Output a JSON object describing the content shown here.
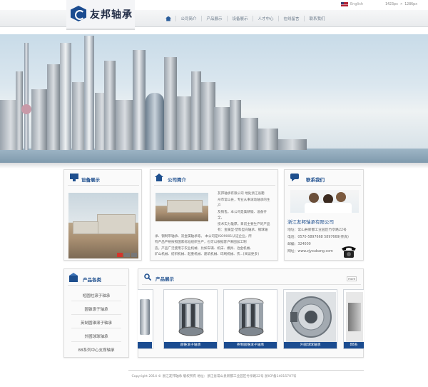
{
  "header": {
    "language": "English",
    "dimensions_note": "1423px × 1286px",
    "logo_text": "友邦轴承"
  },
  "nav": {
    "items": [
      "公司简介",
      "产品展示",
      "设备展示",
      "人才中心",
      "在线留言",
      "联系我们"
    ]
  },
  "equipment": {
    "title": "设备展示"
  },
  "about": {
    "title": "公司简介",
    "lines": [
      "友邦轴承有限公司 地处浙江省衢",
      "州市常山县，专业从事滚动轴承的生产",
      "及销售。本公司是集精锻、设备齐全，",
      "技术实力雄厚。目前主要生产的产品",
      "有：金属型·塑料型向轴承、钢球轴",
      "承、钢制带轴承、双金属轴承等。   本公司是ISO9001认证企业，所",
      "有产品严格按照国家标准组织生产，也可以根据客户来图加工制",
      "造。产品广泛使用于农业机械、比如车辆、机床、模具、冶金机械、",
      "矿山机械、纺织机械、起重机械、建筑机械、印刷机械、农...[阅读更多]"
    ]
  },
  "contact": {
    "title": "联系我们",
    "company": "浙江友邦轴承有限公司",
    "address": "地址：常山县新都工业园区竹亭路22号",
    "phone": "电话：0570-5897668 5897669(传真)",
    "postcode": "邮编：324000",
    "website": "网址：www.zjyoubang.com"
  },
  "categories": {
    "title": "产品各类",
    "items": [
      "短圆柱滚子轴承",
      "圆锥滚子轴承",
      "英制圆锥滚子轴承",
      "外圆球球轴承",
      "88系列中心支撑轴承"
    ]
  },
  "products": {
    "title": "产品展示",
    "more": "more",
    "items": [
      "圆锥滚子轴承",
      "英制圆锥滚子轴承",
      "外圆球球轴承",
      "88系"
    ]
  },
  "footer": {
    "text": "Copyright 2014 © 浙江友邦轴承 版权所有 地址：浙江省常山县新都工业园区竹亭路22号 浙ICP备14015707号"
  }
}
